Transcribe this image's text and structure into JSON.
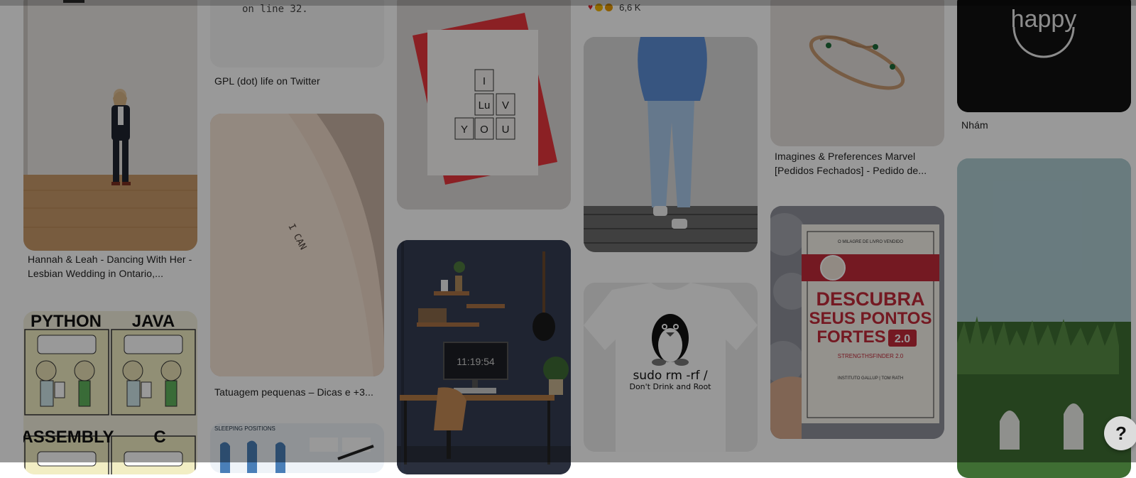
{
  "pins": {
    "hannah": {
      "caption": "Hannah & Leah - Dancing With Her - Lesbian Wedding in Ontario,..."
    },
    "python_java": {
      "labels": [
        "PYTHON",
        "JAVA",
        "ASSEMBLY",
        "C"
      ]
    },
    "gpl": {
      "code_fragment": "on line 32.",
      "caption": "GPL (dot) life on Twitter"
    },
    "tattoo": {
      "ink_text": "I CAN",
      "caption": "Tatuagem pequenas – Dicas e +3..."
    },
    "sleeping": {
      "header_text": "SLEEPING POSITIONS"
    },
    "card": {
      "tiles": [
        "I",
        "Lu",
        "V",
        "Y",
        "O",
        "U"
      ]
    },
    "desk": {
      "clock_text": "11:19:54"
    },
    "fashion": {
      "reaction_count": "6,6 K"
    },
    "shirt": {
      "line1": "sudo rm -rf /",
      "line2": "Don't Drink and Root"
    },
    "ring": {
      "caption": "Imagines & Preferences Marvel [Pedidos Fechados] - Pedido de..."
    },
    "book": {
      "top_line": "O MILAGRE DE LIVRO VENDIDO",
      "title_lines": [
        "DESCUBRA",
        "SEUS PONTOS",
        "FORTES"
      ],
      "badge": "2.0",
      "sub": "STRENGTHSFINDER 2.0",
      "footer": "INSTITUTO GALLUP | TOM RATH"
    },
    "happy": {
      "logo_text": "happy",
      "caption": "Nhám"
    }
  },
  "help_button": {
    "label": "?"
  },
  "colors": {
    "overlay": "rgba(0,0,0,0.40)",
    "card_red": "#e8363c",
    "desk_wall": "#3a4257",
    "sky": "#aeccd2",
    "book_red": "#c22a3a"
  }
}
